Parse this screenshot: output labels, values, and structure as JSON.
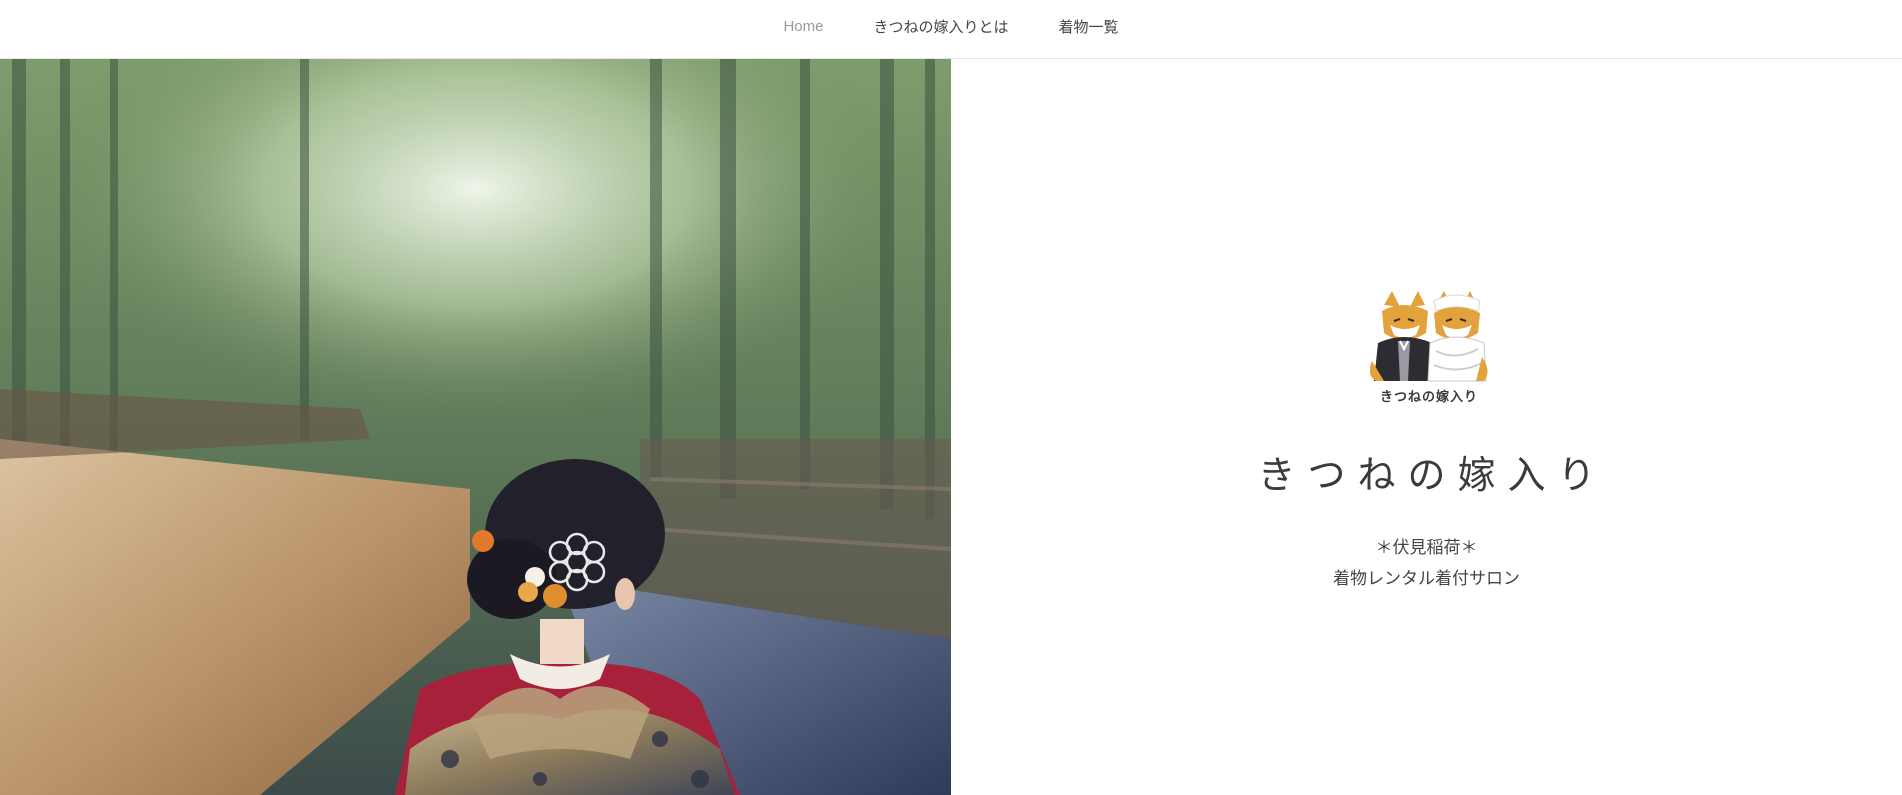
{
  "nav": {
    "items": [
      {
        "label": "Home"
      },
      {
        "label": "きつねの嫁入りとは"
      },
      {
        "label": "着物一覧"
      }
    ]
  },
  "brand": {
    "logo_caption": "きつねの嫁入り",
    "title": "きつねの嫁入り",
    "tagline_line1": "＊伏見稲荷＊",
    "tagline_line2": "着物レンタル着付サロン"
  },
  "colors": {
    "nav_active": "#9a9a9a",
    "nav_text": "#444444",
    "title_text": "#3b3b3b",
    "kimono_red": "#a8213a",
    "fox_orange": "#e4a23c"
  },
  "icons": [
    "fox-couple-logo-icon"
  ]
}
